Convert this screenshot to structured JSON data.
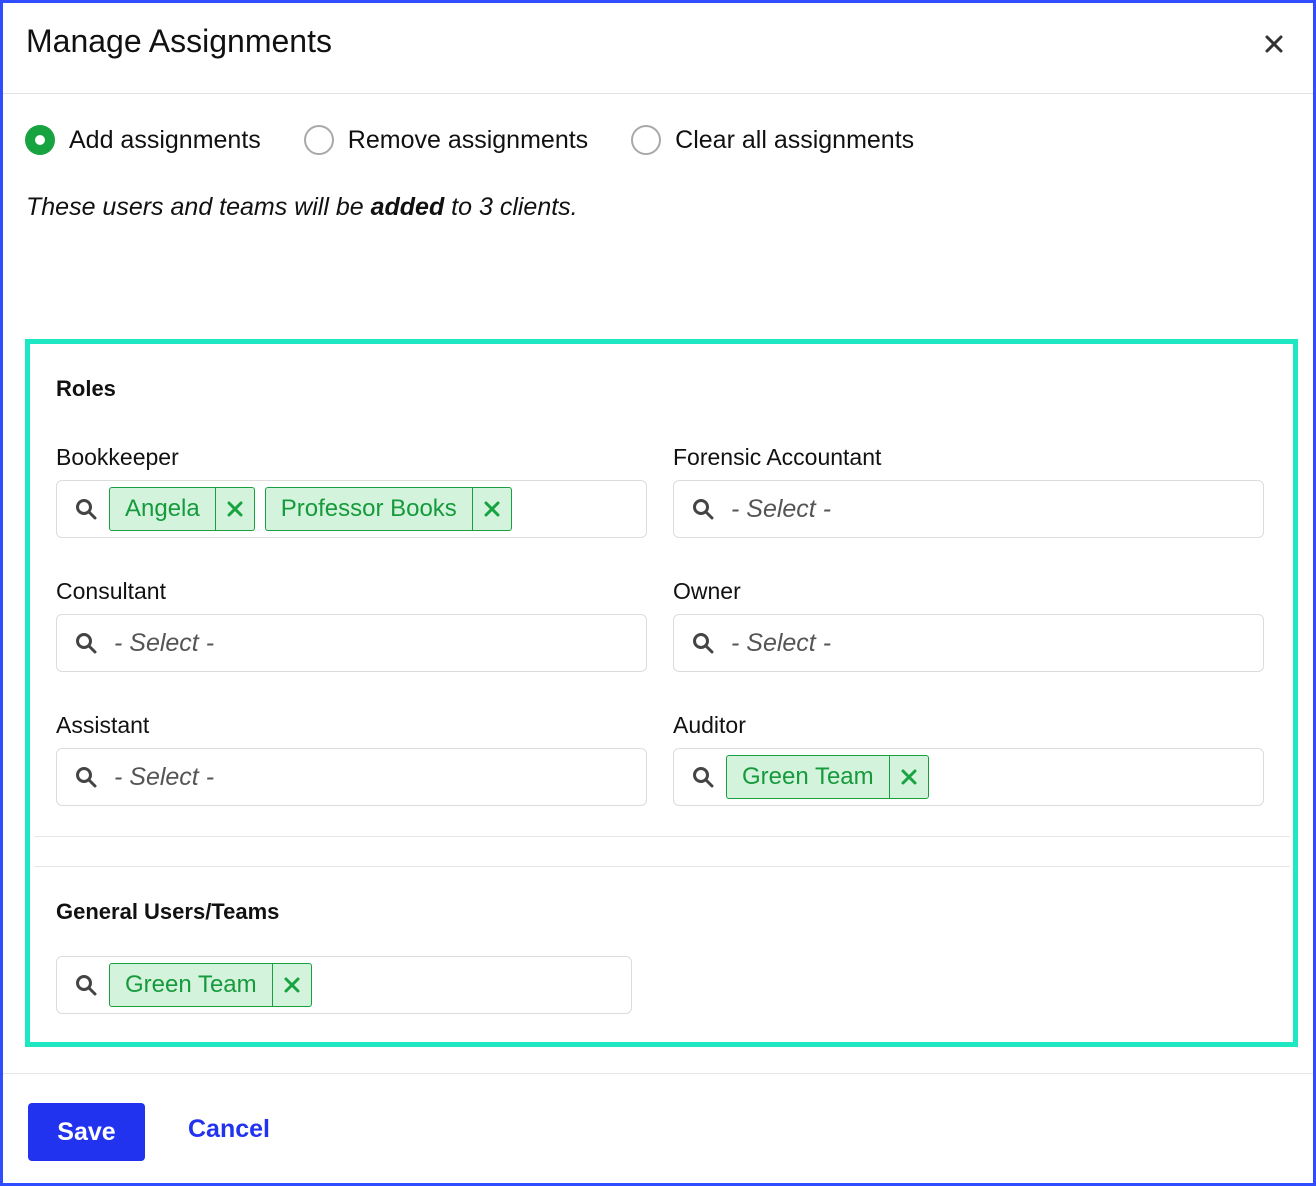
{
  "dialog": {
    "title": "Manage Assignments",
    "close_icon": "close-icon"
  },
  "mode": {
    "options": [
      {
        "label": "Add assignments",
        "checked": true
      },
      {
        "label": "Remove assignments",
        "checked": false
      },
      {
        "label": "Clear all assignments",
        "checked": false
      }
    ],
    "summary": {
      "prefix": "These users and teams will be ",
      "action": "added",
      "suffix": " to 3 clients."
    }
  },
  "roles": {
    "title": "Roles",
    "fields": [
      {
        "label": "Bookkeeper",
        "selected": [
          "Angela",
          "Professor Books"
        ],
        "placeholder": ""
      },
      {
        "label": "Forensic Accountant",
        "selected": [],
        "placeholder": "- Select -"
      },
      {
        "label": "Consultant",
        "selected": [],
        "placeholder": "- Select -"
      },
      {
        "label": "Owner",
        "selected": [],
        "placeholder": "- Select -"
      },
      {
        "label": "Assistant",
        "selected": [],
        "placeholder": "- Select -"
      },
      {
        "label": "Auditor",
        "selected": [
          "Green Team"
        ],
        "placeholder": ""
      }
    ]
  },
  "general": {
    "title": "General Users/Teams",
    "selected": [
      "Green Team"
    ]
  },
  "footer": {
    "save_label": "Save",
    "cancel_label": "Cancel"
  },
  "colors": {
    "accent": "#2233f0",
    "radio_checked": "#17a340",
    "chip_bg": "#d3f3dc",
    "chip_text": "#179a3c",
    "highlight_border": "#1ee8c4",
    "modal_border": "#2f4cff"
  },
  "icons": {
    "search": "search-icon",
    "remove": "remove-chip-icon"
  }
}
